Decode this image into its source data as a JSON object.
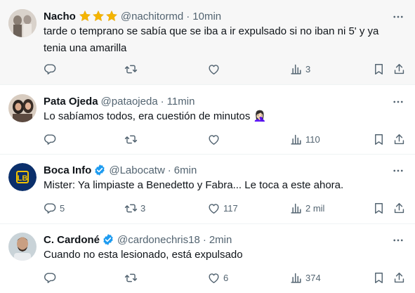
{
  "tweets": [
    {
      "name": "Nacho",
      "handle": "@nachitormd",
      "dot": "·",
      "time": "10min",
      "text_line1": "tarde o temprano se sabía que se iba a ir expulsado si no iban ni 5' y ya",
      "text_line2": "tenia una amarilla",
      "replies": "",
      "retweets": "",
      "likes": "",
      "views": "3",
      "badge": "three-stars"
    },
    {
      "name": "Pata Ojeda",
      "handle": "@pataojeda",
      "dot": "·",
      "time": "11min",
      "text_line1": "Lo sabíamos todos, era cuestión de minutos 🤦🏻‍♀️",
      "replies": "",
      "retweets": "",
      "likes": "",
      "views": "110",
      "badge": "none"
    },
    {
      "name": "Boca Info",
      "handle": "@Labocatw",
      "dot": "·",
      "time": "6min",
      "text_line1": "Mister: Ya limpiaste a Benedetto y Fabra... Le toca a este ahora.",
      "replies": "5",
      "retweets": "3",
      "likes": "117",
      "views": "2 mil",
      "badge": "verified"
    },
    {
      "name": "C. Cardoné",
      "handle": "@cardonechris18",
      "dot": "·",
      "time": "2min",
      "text_line1": "Cuando no esta lesionado, está expulsado",
      "replies": "",
      "retweets": "",
      "likes": "6",
      "views": "374",
      "badge": "verified"
    }
  ],
  "colors": {
    "text": "#0f1419",
    "secondary": "#536471",
    "verified": "#1d9bf0",
    "star": "#f4b400",
    "highlight_bg": "#f7f7f7",
    "divider": "#eff3f4"
  },
  "icons": [
    "reply-icon",
    "retweet-icon",
    "like-icon",
    "views-icon",
    "bookmark-icon",
    "share-icon",
    "more-icon",
    "verified-icon",
    "star-icon"
  ]
}
